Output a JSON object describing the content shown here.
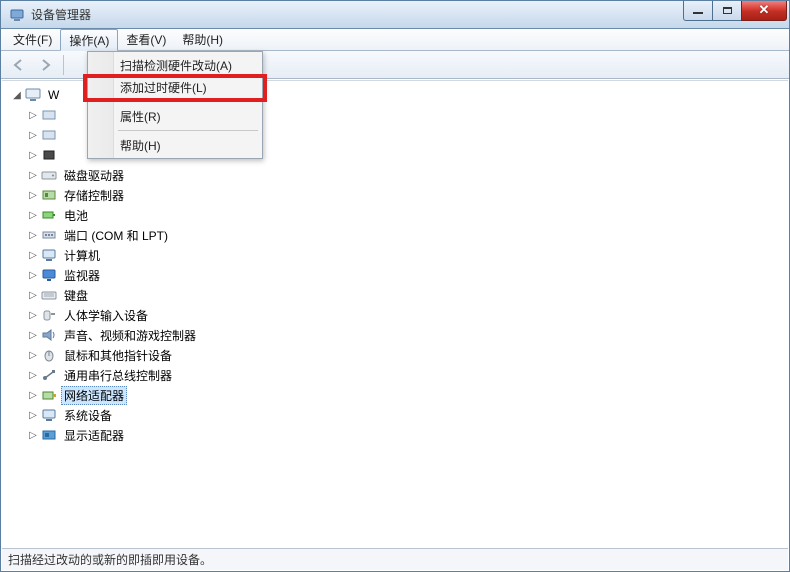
{
  "window": {
    "title": "设备管理器"
  },
  "menubar": {
    "file": "文件(F)",
    "action": "操作(A)",
    "view": "查看(V)",
    "help": "帮助(H)"
  },
  "context_menu": {
    "scan_changes": "扫描检测硬件改动(A)",
    "add_legacy": "添加过时硬件(L)",
    "properties": "属性(R)",
    "help": "帮助(H)"
  },
  "tree": {
    "root_label": "W",
    "items": [
      {
        "label": "磁盘驱动器"
      },
      {
        "label": "存储控制器"
      },
      {
        "label": "电池"
      },
      {
        "label": "端口 (COM 和 LPT)"
      },
      {
        "label": "计算机"
      },
      {
        "label": "监视器"
      },
      {
        "label": "键盘"
      },
      {
        "label": "人体学输入设备"
      },
      {
        "label": "声音、视频和游戏控制器"
      },
      {
        "label": "鼠标和其他指针设备"
      },
      {
        "label": "通用串行总线控制器"
      },
      {
        "label": "网络适配器",
        "selected": true
      },
      {
        "label": "系统设备"
      },
      {
        "label": "显示适配器"
      }
    ]
  },
  "statusbar": {
    "text": "扫描经过改动的或新的即插即用设备。"
  }
}
